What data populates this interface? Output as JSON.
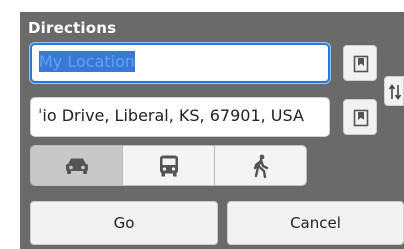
{
  "dialog": {
    "title": "Directions"
  },
  "start": {
    "value": "My Location"
  },
  "destination": {
    "value": "ˈio Drive, Liberal, KS, 67901, USA"
  },
  "icons": {
    "bookmark": "bookmark-icon",
    "swap": "swap-icon",
    "car": "car-icon",
    "bus": "bus-icon",
    "walk": "walk-icon"
  },
  "modes": [
    {
      "name": "car",
      "selected": true
    },
    {
      "name": "transit",
      "selected": false
    },
    {
      "name": "walking",
      "selected": false
    }
  ],
  "actions": {
    "go": "Go",
    "cancel": "Cancel"
  },
  "colors": {
    "panel": "#6a6a6a",
    "accent": "#2a78d8",
    "selection": "#3b78d2"
  }
}
